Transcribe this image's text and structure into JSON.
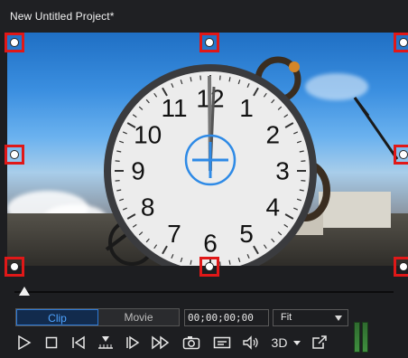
{
  "window": {
    "title": "New Untitled Project*"
  },
  "playback": {
    "mode_options": [
      "Clip",
      "Movie"
    ],
    "active_mode": "Clip",
    "timecode": "00;00;00;00",
    "zoom": "Fit",
    "scrub_position": 0,
    "threed_label": "3D"
  },
  "clock": {
    "numbers": [
      "12",
      "1",
      "2",
      "3",
      "4",
      "5",
      "6",
      "7",
      "8",
      "9",
      "10",
      "11"
    ],
    "accent": "#2e8ae6"
  },
  "icons": [
    "play-icon",
    "stop-icon",
    "previous-frame-icon",
    "split-icon",
    "next-frame-icon",
    "fast-forward-icon",
    "snapshot-icon",
    "subtitles-icon",
    "volume-icon",
    "3d-dropdown-icon",
    "external-display-icon"
  ],
  "colors": {
    "handle_border": "#e01818",
    "active_mode_text": "#4ea3ff"
  }
}
